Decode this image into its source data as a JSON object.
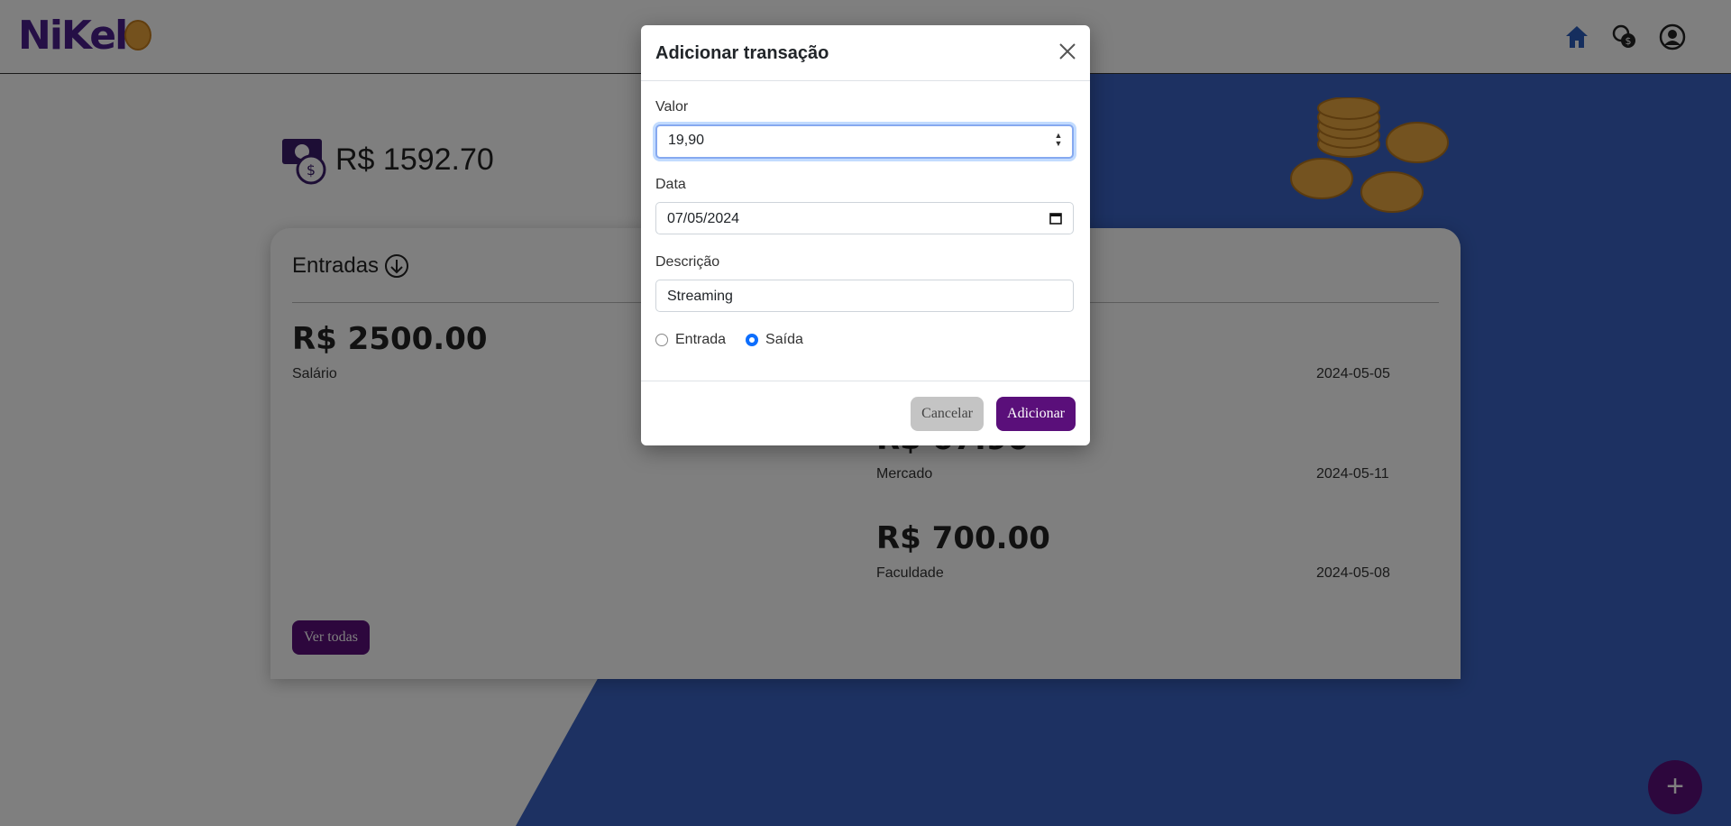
{
  "brand": {
    "logo_text": "NiKel"
  },
  "nav": {
    "home_icon": "home-icon",
    "transactions_icon": "coins-dollar-icon",
    "profile_icon": "user-circle-icon"
  },
  "balance": {
    "text": "R$ 1592.70"
  },
  "entradas": {
    "title": "Entradas",
    "items": [
      {
        "amount": "R$ 2500.00",
        "description": "Salário"
      }
    ],
    "see_all": "Ver todas"
  },
  "saidas": {
    "items": [
      {
        "amount": "",
        "description": "",
        "date": "2024-05-05"
      },
      {
        "amount": "R$ 67.90",
        "description": "Mercado",
        "date": "2024-05-11"
      },
      {
        "amount": "R$ 700.00",
        "description": "Faculdade",
        "date": "2024-05-08"
      }
    ]
  },
  "fab": {
    "label": "+"
  },
  "modal": {
    "title": "Adicionar transação",
    "valor_label": "Valor",
    "valor_value": "19,90",
    "data_label": "Data",
    "data_value": "07/05/2024",
    "descricao_label": "Descrição",
    "descricao_value": "Streaming",
    "type_options": [
      "Entrada",
      "Saída"
    ],
    "type_selected": "Saída",
    "cancel": "Cancelar",
    "submit": "Adicionar"
  },
  "colors": {
    "primary": "#5a0f7a",
    "background_accent": "#3a63c4",
    "focus": "#0d6efd"
  }
}
